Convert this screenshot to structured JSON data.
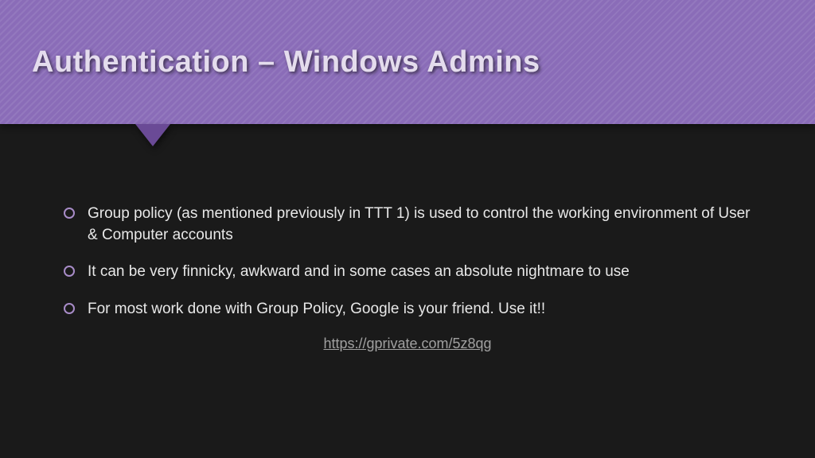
{
  "title": "Authentication – Windows Admins",
  "bullets": [
    "Group policy (as mentioned previously in TTT 1) is used to control the working environment of User & Computer accounts",
    "It can be very finnicky, awkward and in some cases an absolute nightmare to use",
    "For most work done with Group Policy, Google is your friend. Use it!!"
  ],
  "link": {
    "text": "https://gprivate.com/5z8qg",
    "href": "https://gprivate.com/5z8qg"
  },
  "colors": {
    "header_bg": "#8a6cb8",
    "slide_bg": "#1a1a1a",
    "bullet_ring": "#a88cc8",
    "text": "#e8e8e8",
    "link": "#a0a0a0"
  }
}
